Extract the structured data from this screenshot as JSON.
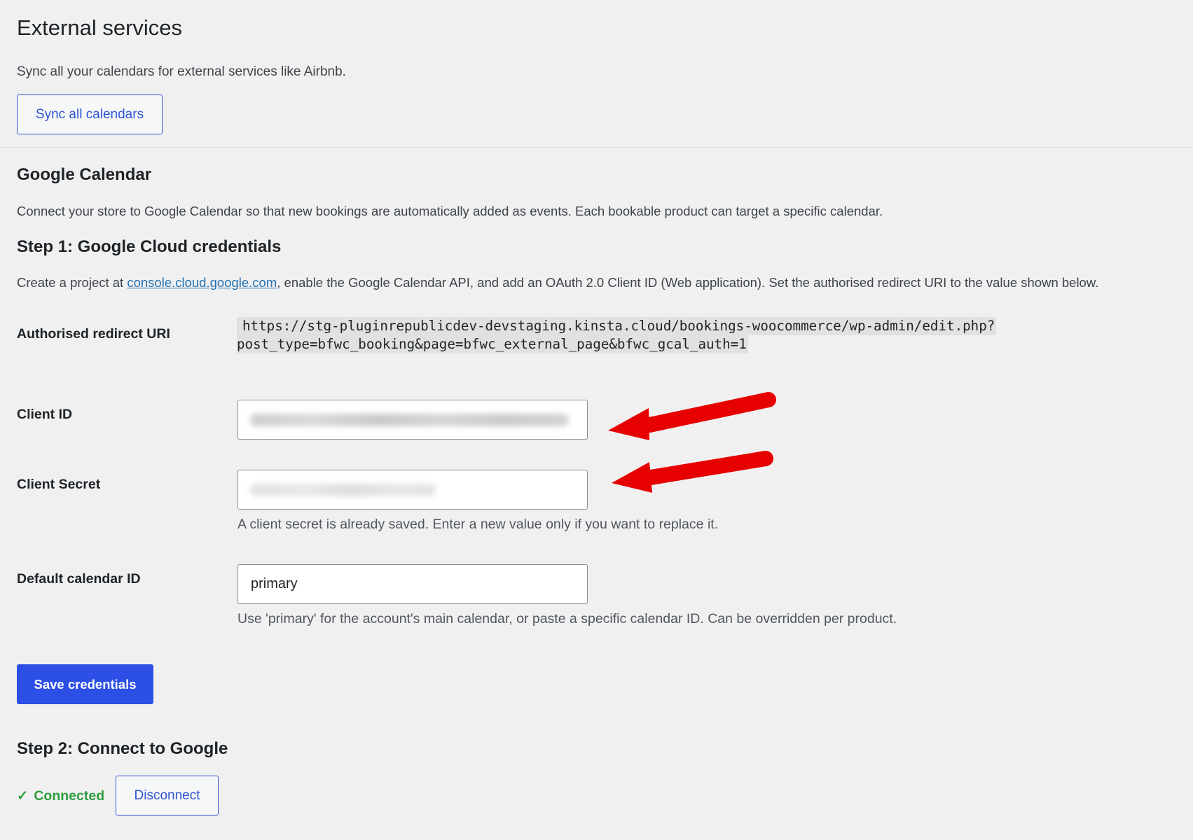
{
  "page": {
    "title": "External services",
    "intro": "Sync all your calendars for external services like Airbnb.",
    "sync_button": "Sync all calendars"
  },
  "google_calendar": {
    "heading": "Google Calendar",
    "description": "Connect your store to Google Calendar so that new bookings are automatically added as events. Each bookable product can target a specific calendar."
  },
  "step1": {
    "heading": "Step 1: Google Cloud credentials",
    "desc_before": "Create a project at ",
    "link_text": "console.cloud.google.com",
    "desc_after": ", enable the Google Calendar API, and add an OAuth 2.0 Client ID (Web application). Set the authorised redirect URI to the value shown below."
  },
  "fields": {
    "redirect_uri": {
      "label": "Authorised redirect URI",
      "line1": "https://stg-pluginrepublicdev-devstaging.kinsta.cloud/bookings-woocommerce/wp-admin/edit.php?",
      "line2": "post_type=bfwc_booking&page=bfwc_external_page&bfwc_gcal_auth=1"
    },
    "client_id": {
      "label": "Client ID",
      "value": ""
    },
    "client_secret": {
      "label": "Client Secret",
      "value": "",
      "help": "A client secret is already saved. Enter a new value only if you want to replace it."
    },
    "default_calendar": {
      "label": "Default calendar ID",
      "value": "primary",
      "help": "Use 'primary' for the account's main calendar, or paste a specific calendar ID. Can be overridden per product."
    }
  },
  "save_button": "Save credentials",
  "step2": {
    "heading": "Step 2: Connect to Google",
    "status_icon": "✓",
    "status_text": "Connected",
    "disconnect_button": "Disconnect"
  },
  "colors": {
    "accent": "#2c4fe6",
    "link": "#2271b1",
    "success": "#2e9e3f",
    "annotation_arrow": "#e60000"
  },
  "icons": [
    "check-icon",
    "annotation-arrow-icon"
  ]
}
